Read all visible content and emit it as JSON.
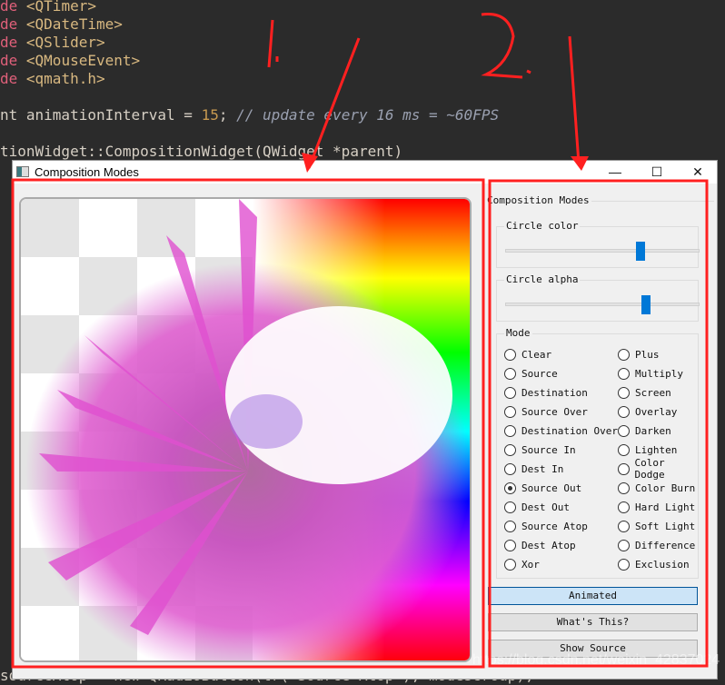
{
  "code_lines": [
    {
      "a": "de ",
      "b": "<QTimer>"
    },
    {
      "a": "de ",
      "b": "<QDateTime>"
    },
    {
      "a": "de ",
      "b": "<QSlider>"
    },
    {
      "a": "de ",
      "b": "<QMouseEvent>"
    },
    {
      "a": "de ",
      "b": "<qmath.h>"
    }
  ],
  "code_interval": {
    "pre": "nt animationInterval = ",
    "num": "15",
    "post": "; ",
    "comment": "// update every 16 ms = ~60FPS"
  },
  "code_ctor": "tionWidget::CompositionWidget(QWidget *parent)",
  "code_bottom": "sourceAtop = new QRadioButton(tr(\"Source Atop\"), modesGroup);",
  "window": {
    "title": "Composition Modes",
    "minimize": "—",
    "maximize": "☐",
    "close": "✕"
  },
  "panel": {
    "group_title": "Composition Modes",
    "circle_color": {
      "label": "Circle color",
      "value_percent": 70
    },
    "circle_alpha": {
      "label": "Circle alpha",
      "value_percent": 73
    },
    "mode_label": "Mode",
    "modes_left": [
      "Clear",
      "Source",
      "Destination",
      "Source Over",
      "Destination Over",
      "Source In",
      "Dest In",
      "Source Out",
      "Dest Out",
      "Source Atop",
      "Dest Atop",
      "Xor"
    ],
    "modes_right": [
      "Plus",
      "Multiply",
      "Screen",
      "Overlay",
      "Darken",
      "Lighten",
      "Color Dodge",
      "Color Burn",
      "Hard Light",
      "Soft Light",
      "Difference",
      "Exclusion"
    ],
    "selected_mode": "Source Out",
    "animated": "Animated",
    "whats_this": "What's This?",
    "show_source": "Show Source"
  },
  "annotations": {
    "one": "1.",
    "two": "2.",
    "color": "#ff2020"
  },
  "watermark": "https://blog.csdn.net/weixin_42837024",
  "accent": "#0078d7"
}
